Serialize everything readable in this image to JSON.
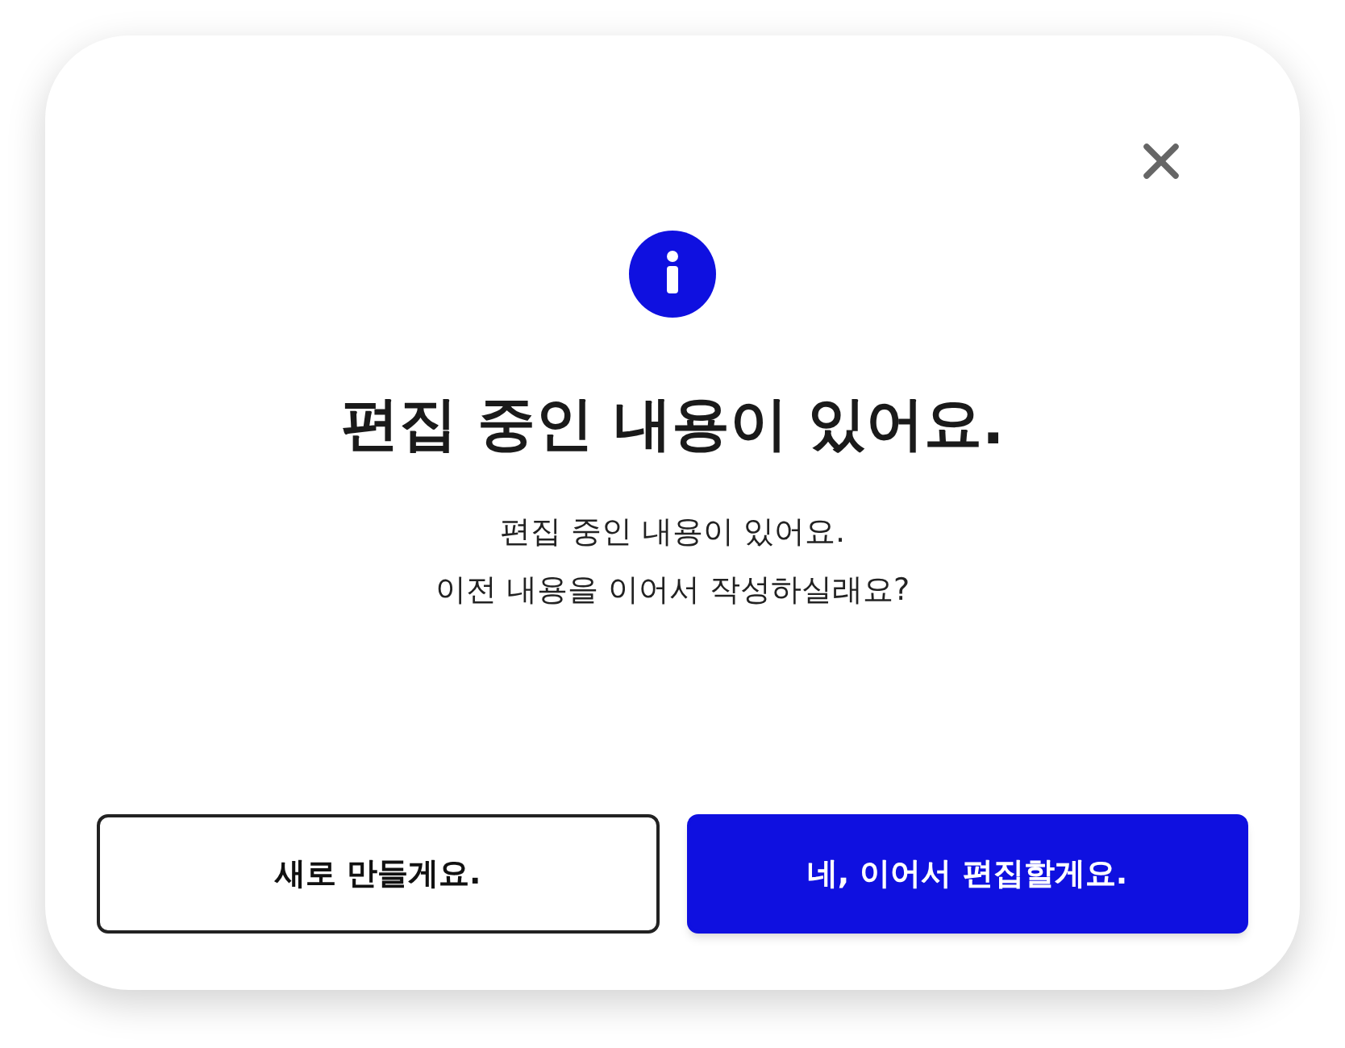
{
  "dialog": {
    "title": "편집 중인 내용이 있어요.",
    "message": [
      "편집 중인 내용이 있어요.",
      "이전 내용을 이어서 작성하실래요?"
    ],
    "buttons": [
      {
        "label": "새로 만들게요.",
        "kind": "secondary"
      },
      {
        "label": "네, 이어서 편집할게요.",
        "kind": "primary"
      }
    ]
  }
}
